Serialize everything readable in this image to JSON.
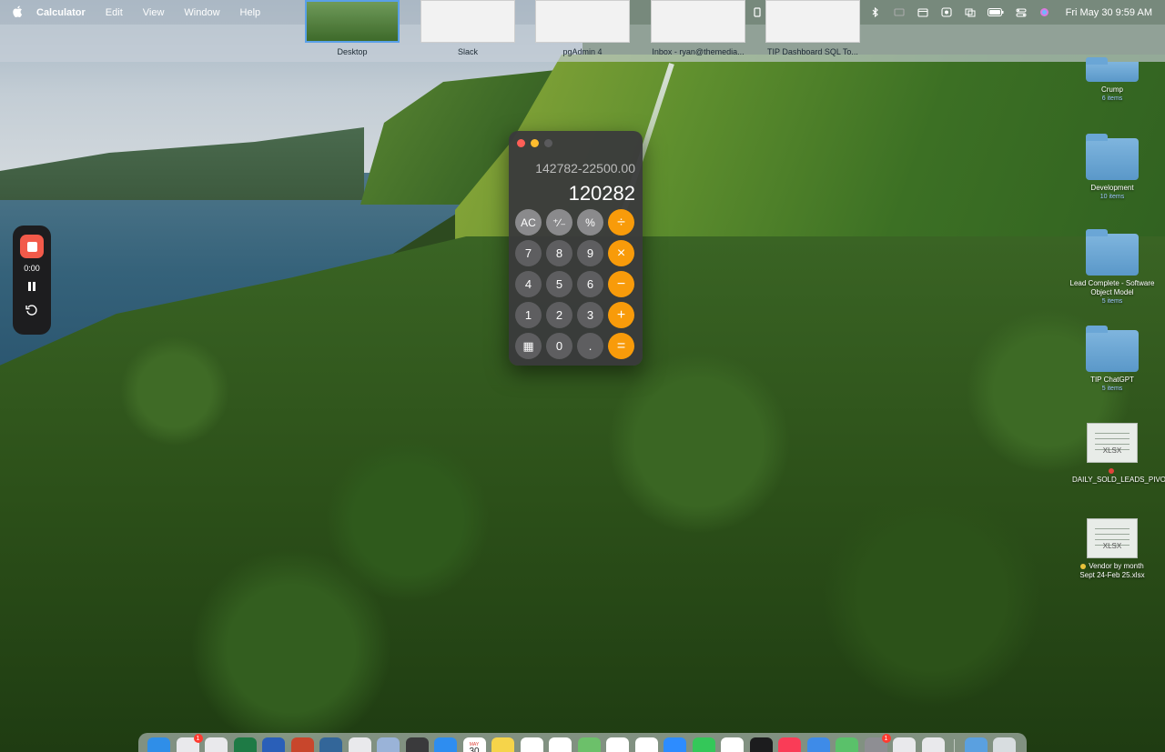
{
  "menubar": {
    "app_name": "Calculator",
    "menus": [
      "Edit",
      "View",
      "Window",
      "Help"
    ],
    "datetime": "Fri May 30  9:59 AM"
  },
  "spaces": [
    {
      "label": "Desktop",
      "active": true
    },
    {
      "label": "Slack",
      "active": false
    },
    {
      "label": "pgAdmin 4",
      "active": false
    },
    {
      "label": "Inbox - ryan@themedia...",
      "active": false
    },
    {
      "label": "TIP Dashboard SQL To...",
      "active": false
    }
  ],
  "recorder": {
    "time": "0:00"
  },
  "calculator": {
    "expression": "142782-22500.00",
    "result": "120282",
    "keys": [
      {
        "label": "AC",
        "kind": "fn"
      },
      {
        "label": "⁺∕₋",
        "kind": "fn"
      },
      {
        "label": "%",
        "kind": "fn"
      },
      {
        "label": "÷",
        "kind": "op"
      },
      {
        "label": "7",
        "kind": "num"
      },
      {
        "label": "8",
        "kind": "num"
      },
      {
        "label": "9",
        "kind": "num"
      },
      {
        "label": "×",
        "kind": "op"
      },
      {
        "label": "4",
        "kind": "num"
      },
      {
        "label": "5",
        "kind": "num"
      },
      {
        "label": "6",
        "kind": "num"
      },
      {
        "label": "−",
        "kind": "op"
      },
      {
        "label": "1",
        "kind": "num"
      },
      {
        "label": "2",
        "kind": "num"
      },
      {
        "label": "3",
        "kind": "num"
      },
      {
        "label": "+",
        "kind": "op"
      },
      {
        "label": "▦",
        "kind": "num"
      },
      {
        "label": "0",
        "kind": "num"
      },
      {
        "label": ".",
        "kind": "num"
      },
      {
        "label": "=",
        "kind": "op"
      }
    ]
  },
  "desktop": {
    "items": [
      {
        "name": "Crump",
        "sub": "6 items",
        "type": "folder"
      },
      {
        "name": "Development",
        "sub": "10 items",
        "type": "folder"
      },
      {
        "name": "Lead Complete - Software Object Model",
        "sub": "5 items",
        "type": "folder"
      },
      {
        "name": "TIP ChatGPT",
        "sub": "5 items",
        "type": "folder"
      },
      {
        "name": "DAILY_SOLD_LEADS_PIVOT_TikTok.xlsx",
        "sub": "",
        "type": "doc",
        "ext": "XLSX",
        "tag": "#e0443a"
      },
      {
        "name": "Vendor by month Sept 24-Feb 25.xlsx",
        "sub": "",
        "type": "doc",
        "ext": "XLSX",
        "tag": "#e8c23a"
      }
    ]
  },
  "dock": {
    "calendar_month": "MAY",
    "calendar_day": "30",
    "apps": [
      {
        "name": "finder",
        "color": "#2f8ee8",
        "badge": ""
      },
      {
        "name": "slack",
        "color": "#e9e9ec",
        "badge": "1"
      },
      {
        "name": "chrome",
        "color": "#e9e9ec",
        "badge": ""
      },
      {
        "name": "excel",
        "color": "#1e7a45",
        "badge": ""
      },
      {
        "name": "word",
        "color": "#2a5fb8",
        "badge": ""
      },
      {
        "name": "powerpoint",
        "color": "#c8462c",
        "badge": ""
      },
      {
        "name": "pgadmin",
        "color": "#336699",
        "badge": ""
      },
      {
        "name": "textedit",
        "color": "#e9e9ec",
        "badge": ""
      },
      {
        "name": "preview",
        "color": "#9ab3d8",
        "badge": ""
      },
      {
        "name": "calculator",
        "color": "#3a3a3c",
        "badge": ""
      },
      {
        "name": "safari",
        "color": "#2e8df0",
        "badge": ""
      },
      {
        "name": "calendar",
        "color": "#ffffff",
        "badge": ""
      },
      {
        "name": "notes",
        "color": "#f6d44a",
        "badge": ""
      },
      {
        "name": "reminders",
        "color": "#ffffff",
        "badge": ""
      },
      {
        "name": "chatgpt",
        "color": "#ffffff",
        "badge": ""
      },
      {
        "name": "maps",
        "color": "#6cc06a",
        "badge": ""
      },
      {
        "name": "photos-booth",
        "color": "#ffffff",
        "badge": ""
      },
      {
        "name": "clock",
        "color": "#ffffff",
        "badge": ""
      },
      {
        "name": "zoom",
        "color": "#2d8cff",
        "badge": ""
      },
      {
        "name": "messages",
        "color": "#34c759",
        "badge": ""
      },
      {
        "name": "photos",
        "color": "#ffffff",
        "badge": ""
      },
      {
        "name": "apple-tv",
        "color": "#1c1c1e",
        "badge": ""
      },
      {
        "name": "music",
        "color": "#fa3c57",
        "badge": ""
      },
      {
        "name": "app-store-folder",
        "color": "#3e8be8",
        "badge": ""
      },
      {
        "name": "maps-2",
        "color": "#5ac16a",
        "badge": ""
      },
      {
        "name": "system-settings",
        "color": "#8e8e93",
        "badge": "1"
      },
      {
        "name": "launchpad",
        "color": "#e9e9ec",
        "badge": ""
      },
      {
        "name": "windows-app",
        "color": "#e9e9ec",
        "badge": ""
      }
    ],
    "after_sep": [
      {
        "name": "downloads-folder",
        "color": "#5aa0e0"
      },
      {
        "name": "trash",
        "color": "#d8dde0"
      }
    ]
  }
}
